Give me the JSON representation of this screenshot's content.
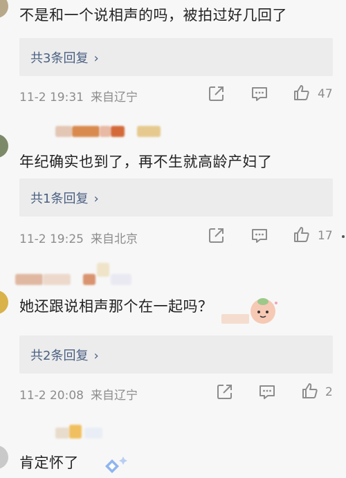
{
  "comments": [
    {
      "text": "不是和一个说相声的吗，被拍过好几回了",
      "reply": "共3条回复",
      "time": "11-2 19:31",
      "location": "来自辽宁",
      "likes": "47"
    },
    {
      "text": "年纪确实也到了，再不生就高龄产妇了",
      "reply": "共1条回复",
      "time": "11-2 19:25",
      "location": "来自北京",
      "likes": "17"
    },
    {
      "text": "她还跟说相声那个在一起吗？",
      "reply": "共2条回复",
      "time": "11-2 20:08",
      "location": "来自辽宁",
      "likes": "2"
    },
    {
      "text": "肯定怀了"
    }
  ],
  "icons": {
    "share": "share-icon",
    "comment": "comment-icon",
    "like": "thumbs-up-icon",
    "chevron": "chevron-right-icon"
  },
  "colors": {
    "link": "#4a5f82",
    "meta": "#8c8c8c",
    "reply_bg": "#ececec"
  }
}
